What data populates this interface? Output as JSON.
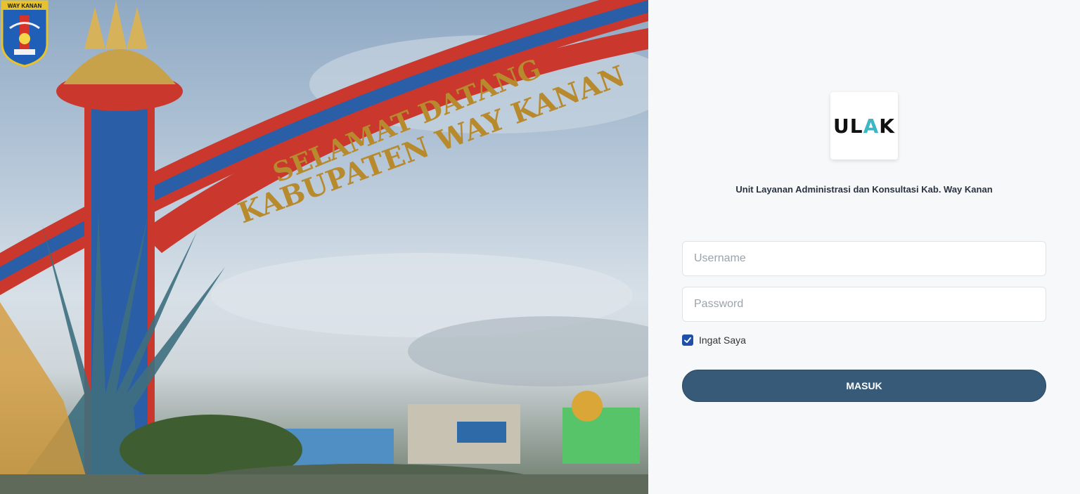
{
  "hero": {
    "gate_text_line1": "SELAMAT DATANG",
    "gate_text_line2": "KABUPATEN WAY KANAN",
    "emblem_label": "WAY KANAN",
    "emblem_icon": "way-kanan-emblem-icon"
  },
  "login": {
    "logo": {
      "part1": "UL",
      "accent": "A",
      "part2": "K"
    },
    "subtitle": "Unit Layanan Administrasi dan Konsultasi Kab. Way Kanan",
    "username_placeholder": "Username",
    "password_placeholder": "Password",
    "remember_label": "Ingat Saya",
    "remember_checked": true,
    "submit_label": "MASUK"
  },
  "colors": {
    "button": "#375a78",
    "checkbox": "#1f4fa8",
    "logo_accent": "#3fb6c6"
  }
}
